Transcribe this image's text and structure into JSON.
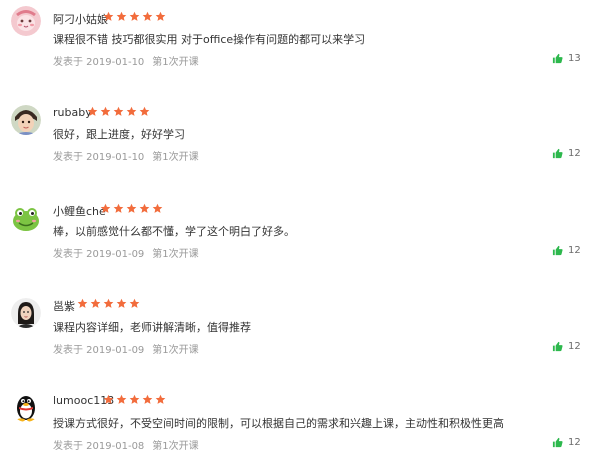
{
  "accent": {
    "star": "#f26c3c",
    "thumb": "#2db84d"
  },
  "reviews": [
    {
      "user": "阿刁小姑娘",
      "avatar_icon": "pink-face-avatar",
      "rating": 5,
      "content": "课程很不错 技巧都很实用 对于office操作有问题的都可以来学习",
      "date_label": "发表于 2019-01-10",
      "lesson_label": "第1次开课",
      "likes": "13"
    },
    {
      "user": "rubaby",
      "avatar_icon": "child-photo-avatar",
      "rating": 5,
      "content": "很好，跟上进度，好好学习",
      "date_label": "发表于 2019-01-10",
      "lesson_label": "第1次开课",
      "likes": "12"
    },
    {
      "user": "小鲤鱼che",
      "avatar_icon": "green-frog-avatar",
      "rating": 5,
      "content": "棒，以前感觉什么都不懂，学了这个明白了好多。",
      "date_label": "发表于 2019-01-09",
      "lesson_label": "第1次开课",
      "likes": "12"
    },
    {
      "user": "邕紫",
      "avatar_icon": "woman-photo-avatar",
      "rating": 5,
      "content": "课程内容详细，老师讲解清晰，值得推荐",
      "date_label": "发表于 2019-01-09",
      "lesson_label": "第1次开课",
      "likes": "12"
    },
    {
      "user": "lumooc113",
      "avatar_icon": "qq-penguin-avatar",
      "rating": 5,
      "content": "授课方式很好，不受空间时间的限制，可以根据自己的需求和兴趣上课，主动性和积极性更高",
      "date_label": "发表于 2019-01-08",
      "lesson_label": "第1次开课",
      "likes": "12"
    }
  ]
}
